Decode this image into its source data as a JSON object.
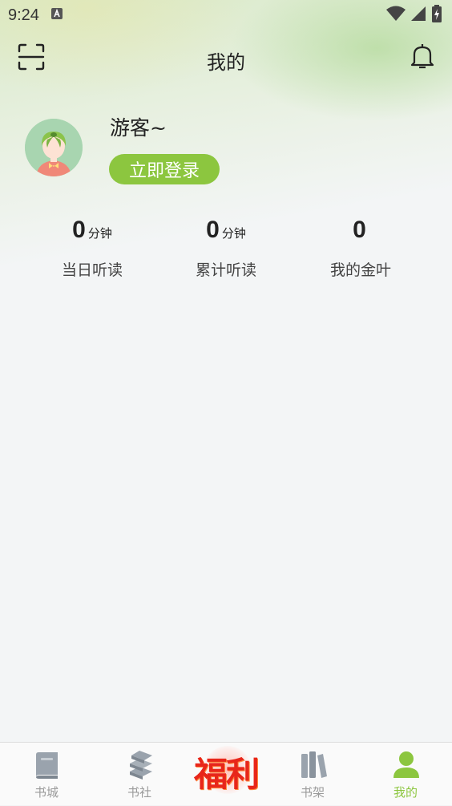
{
  "status_bar": {
    "time": "9:24"
  },
  "header": {
    "title": "我的"
  },
  "profile": {
    "username": "游客~",
    "login_label": "立即登录"
  },
  "stats": [
    {
      "value": "0",
      "unit": "分钟",
      "label": "当日听读"
    },
    {
      "value": "0",
      "unit": "分钟",
      "label": "累计听读"
    },
    {
      "value": "0",
      "unit": "",
      "label": "我的金叶"
    }
  ],
  "tabbar": {
    "tabs": [
      {
        "label": "书城",
        "icon": "book-icon"
      },
      {
        "label": "书社",
        "icon": "books-stack-icon"
      },
      {
        "label": "福利",
        "icon": "welfare-badge"
      },
      {
        "label": "书架",
        "icon": "bookshelf-icon"
      },
      {
        "label": "我的",
        "icon": "user-icon",
        "active": true
      }
    ]
  },
  "colors": {
    "accent": "#8cc63f",
    "welfare": "#e8261a",
    "inactive": "#9a9a9a"
  }
}
